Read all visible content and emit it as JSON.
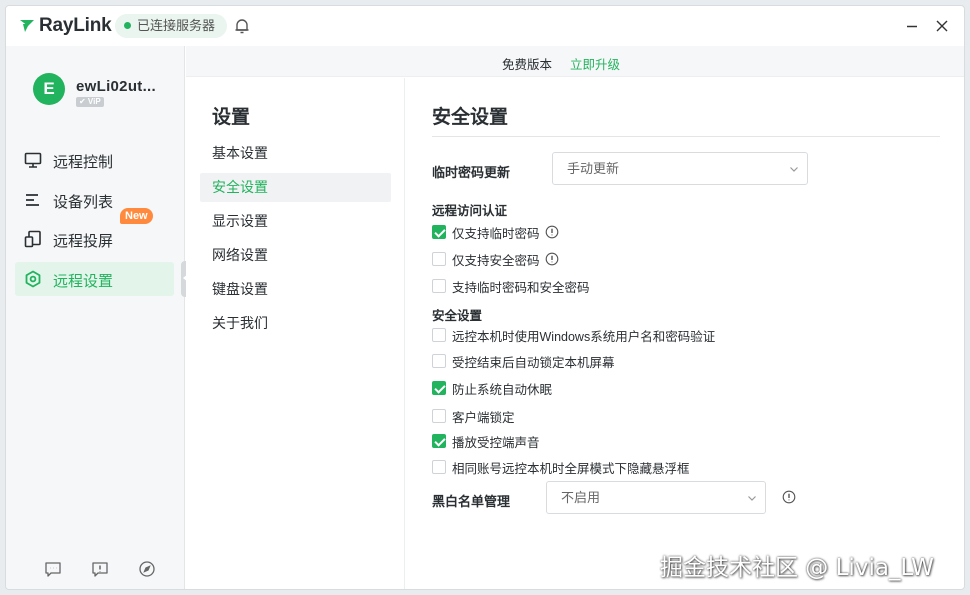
{
  "app": {
    "logo_text": "RayLink",
    "status_text": "已连接服务器",
    "accent_color": "#22b35e"
  },
  "user": {
    "avatar_letter": "E",
    "name": "ewLi02ut...",
    "vip_label": "✔ ViP"
  },
  "sidebar": {
    "items": [
      {
        "label": "远程控制",
        "icon": "monitor-icon",
        "active": false
      },
      {
        "label": "设备列表",
        "icon": "list-icon",
        "active": false
      },
      {
        "label": "远程投屏",
        "icon": "cast-icon",
        "active": false,
        "badge": "New"
      },
      {
        "label": "远程设置",
        "icon": "settings-icon",
        "active": true
      }
    ],
    "footer_icons": [
      "chat-icon",
      "feedback-icon",
      "compass-icon"
    ]
  },
  "topbar": {
    "edition": "免费版本",
    "upgrade": "立即升级"
  },
  "settings_menu": {
    "title": "设置",
    "items": [
      {
        "label": "基本设置",
        "active": false
      },
      {
        "label": "安全设置",
        "active": true
      },
      {
        "label": "显示设置",
        "active": false
      },
      {
        "label": "网络设置",
        "active": false
      },
      {
        "label": "键盘设置",
        "active": false
      },
      {
        "label": "关于我们",
        "active": false
      }
    ]
  },
  "security": {
    "title": "安全设置",
    "temp_password": {
      "label": "临时密码更新",
      "value": "手动更新"
    },
    "remote_auth": {
      "heading": "远程访问认证",
      "options": [
        {
          "label": "仅支持临时密码",
          "checked": true,
          "info": true
        },
        {
          "label": "仅支持安全密码",
          "checked": false,
          "info": true
        },
        {
          "label": "支持临时密码和安全密码",
          "checked": false,
          "info": false
        }
      ]
    },
    "security_options": {
      "heading": "安全设置",
      "options": [
        {
          "label": "远控本机时使用Windows系统用户名和密码验证",
          "checked": false
        },
        {
          "label": "受控结束后自动锁定本机屏幕",
          "checked": false
        },
        {
          "label": "防止系统自动休眠",
          "checked": true
        },
        {
          "label": "客户端锁定",
          "checked": false
        },
        {
          "label": "播放受控端声音",
          "checked": true
        },
        {
          "label": "相同账号远控本机时全屏模式下隐藏悬浮框",
          "checked": false
        }
      ]
    },
    "blacklist": {
      "label": "黑白名单管理",
      "value": "不启用"
    }
  },
  "watermark": "掘金技术社区 @ Livia_LW"
}
